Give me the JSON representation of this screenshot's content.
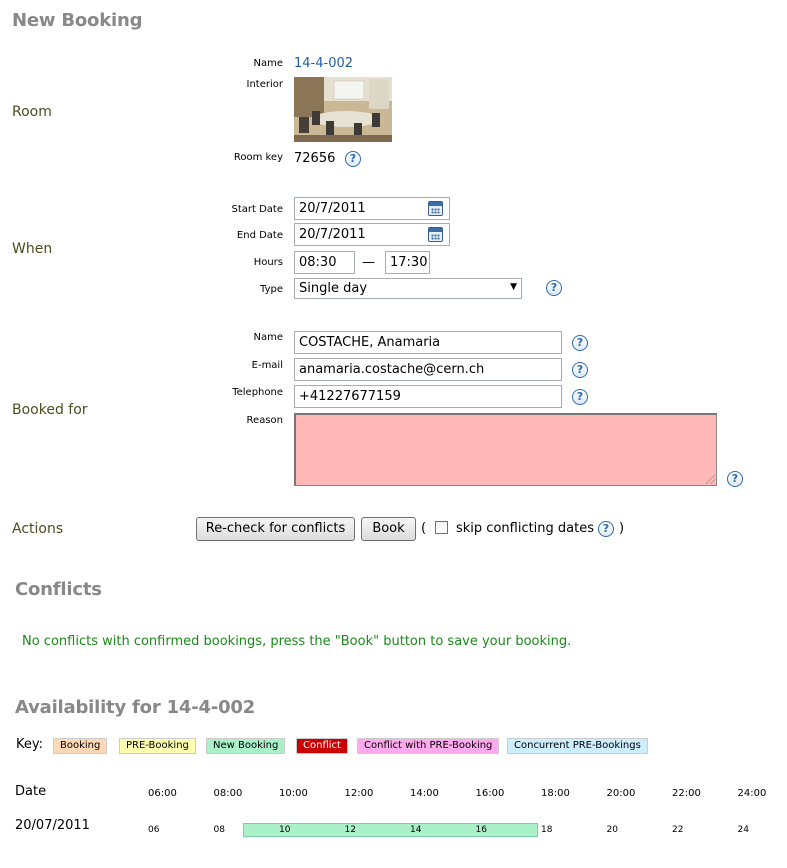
{
  "page_title": "New Booking",
  "room": {
    "section_label": "Room",
    "name_label": "Name",
    "name_value": "14-4-002",
    "interior_label": "Interior",
    "room_key_label": "Room key",
    "room_key_value": "72656"
  },
  "when": {
    "section_label": "When",
    "start_date_label": "Start Date",
    "start_date_value": "20/7/2011",
    "end_date_label": "End Date",
    "end_date_value": "20/7/2011",
    "hours_label": "Hours",
    "hours_from": "08:30",
    "hours_separator": "—",
    "hours_to": "17:30",
    "type_label": "Type",
    "type_value": "Single day"
  },
  "booked_for": {
    "section_label": "Booked for",
    "name_label": "Name",
    "name_value": "COSTACHE, Anamaria",
    "email_label": "E-mail",
    "email_value": "anamaria.costache@cern.ch",
    "telephone_label": "Telephone",
    "telephone_value": "+41227677159",
    "reason_label": "Reason",
    "reason_value": ""
  },
  "actions": {
    "section_label": "Actions",
    "recheck_button": "Re-check for conflicts",
    "book_button": "Book",
    "open_paren": "(",
    "skip_label": "skip conflicting dates",
    "close_paren": ")"
  },
  "help_glyph": "?",
  "conflicts": {
    "title": "Conflicts",
    "message": "No conflicts with confirmed bookings, press the \"Book\" button to save your booking."
  },
  "availability": {
    "title": "Availability for 14-4-002",
    "key_label": "Key:",
    "key_items": [
      {
        "label": "Booking",
        "bg": "#ffd8b8",
        "color": "#000000"
      },
      {
        "label": "PRE-Booking",
        "bg": "#ffffb0",
        "color": "#000000"
      },
      {
        "label": "New Booking",
        "bg": "#aaf0c8",
        "color": "#000000"
      },
      {
        "label": "Conflict",
        "bg": "#cc0000",
        "color": "#ffffff"
      },
      {
        "label": "Conflict with PRE-Booking",
        "bg": "#ffaaee",
        "color": "#000000"
      },
      {
        "label": "Concurrent PRE-Bookings",
        "bg": "#cceeff",
        "color": "#000000"
      }
    ],
    "date_header": "Date",
    "hour_headers": [
      "06:00",
      "08:00",
      "10:00",
      "12:00",
      "14:00",
      "16:00",
      "18:00",
      "20:00",
      "22:00",
      "24:00"
    ],
    "rows": [
      {
        "date": "20/07/2011",
        "hour_marks": [
          "06",
          "08",
          "10",
          "12",
          "14",
          "16",
          "18",
          "20",
          "22",
          "24"
        ],
        "booking_start_hour": 8.5,
        "booking_end_hour": 17.5
      }
    ]
  },
  "colors": {
    "heading": "#888888",
    "section_label": "#4d4d1f",
    "link": "#1f5fa8",
    "success": "#1a8a1a",
    "reason_bg": "#ffb7b7"
  }
}
